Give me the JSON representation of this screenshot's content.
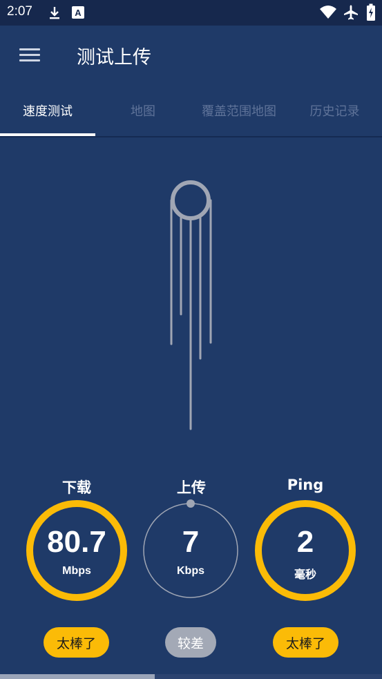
{
  "status_bar": {
    "time": "2:07",
    "icons": [
      "download-icon",
      "text-a-icon",
      "wifi-icon",
      "airplane-icon",
      "battery-icon"
    ]
  },
  "app_bar": {
    "title": "测试上传",
    "menu_icon": "hamburger-menu-icon"
  },
  "tabs": [
    {
      "label": "速度测试",
      "active": true
    },
    {
      "label": "地图",
      "active": false
    },
    {
      "label": "覆盖范围地图",
      "active": false
    },
    {
      "label": "历史记录",
      "active": false
    }
  ],
  "metrics": {
    "download": {
      "label": "下载",
      "value": "80.7",
      "unit": "Mbps",
      "rating": "太棒了"
    },
    "upload": {
      "label": "上传",
      "value": "7",
      "unit": "Kbps",
      "rating": "较差"
    },
    "ping": {
      "label": "Ping",
      "value": "2",
      "unit": "毫秒",
      "rating": "太棒了"
    }
  },
  "colors": {
    "background": "#1f3a68",
    "status_bar": "#16284d",
    "accent_good": "#fbbb07",
    "rating_poor": "#a3a9b6",
    "gauge_gray": "#a0a6b4"
  }
}
